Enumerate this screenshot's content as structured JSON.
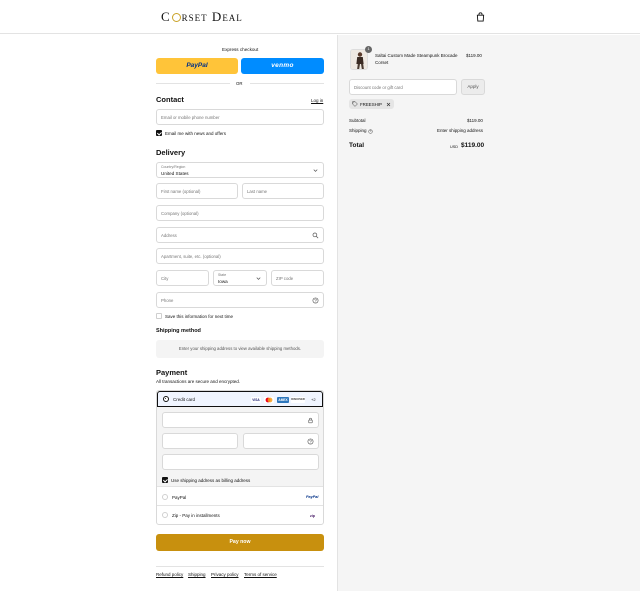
{
  "header": {
    "brand": "Corset Deal",
    "brand_pre": "C",
    "brand_post": "rset Deal",
    "cart_icon": "shopping-bag-icon"
  },
  "express": {
    "title": "Express checkout",
    "paypal_label": "PayPal",
    "venmo_label": "venmo",
    "or_label": "OR",
    "paypal_color": "#ffc439",
    "venmo_color": "#008cff"
  },
  "contact": {
    "title": "Contact",
    "login_link": "Log in",
    "email_placeholder": "Email or mobile phone number",
    "newsletter_label": "Email me with news and offers",
    "newsletter_checked": true
  },
  "delivery": {
    "title": "Delivery",
    "country_label": "Country/Region",
    "country_value": "United States",
    "first_name_placeholder": "First name (optional)",
    "last_name_placeholder": "Last name",
    "company_placeholder": "Company (optional)",
    "address_placeholder": "Address",
    "apartment_placeholder": "Apartment, suite, etc. (optional)",
    "city_placeholder": "City",
    "state_label": "State",
    "state_value": "Iowa",
    "zip_placeholder": "ZIP code",
    "phone_placeholder": "Phone",
    "save_info_label": "Save this information for next time",
    "save_info_checked": false
  },
  "shipping": {
    "title": "Shipping method",
    "note": "Enter your shipping address to view available shipping methods."
  },
  "payment": {
    "title": "Payment",
    "subtitle": "All transactions are secure and encrypted.",
    "credit_card_label": "Credit card",
    "card_logos": [
      "VISA",
      "MC",
      "AMEX",
      "DISCOVER"
    ],
    "more_cards": "+2",
    "billing_label": "Use shipping address as billing address",
    "billing_checked": true,
    "paypal_label": "PayPal",
    "paypal_logo": "PayPal",
    "zip_label": "Zip - Pay in installments",
    "zip_logo": "zip"
  },
  "pay_now_label": "Pay now",
  "pay_now_color": "#c8900e",
  "footer_links": [
    "Refund policy",
    "Shipping",
    "Privacy policy",
    "Terms of service"
  ],
  "summary": {
    "item_name": "Saltai Custom Made Steampunk Brocade Corset",
    "item_qty": "1",
    "item_price": "$119.00",
    "discount_placeholder": "Discount code or gift card",
    "apply_label": "Apply",
    "tag_label": "FREESHIP",
    "subtotal_label": "Subtotal",
    "subtotal_value": "$119.00",
    "shipping_label": "Shipping",
    "shipping_value": "Enter shipping address",
    "total_label": "Total",
    "currency": "USD",
    "total_value": "$119.00"
  }
}
